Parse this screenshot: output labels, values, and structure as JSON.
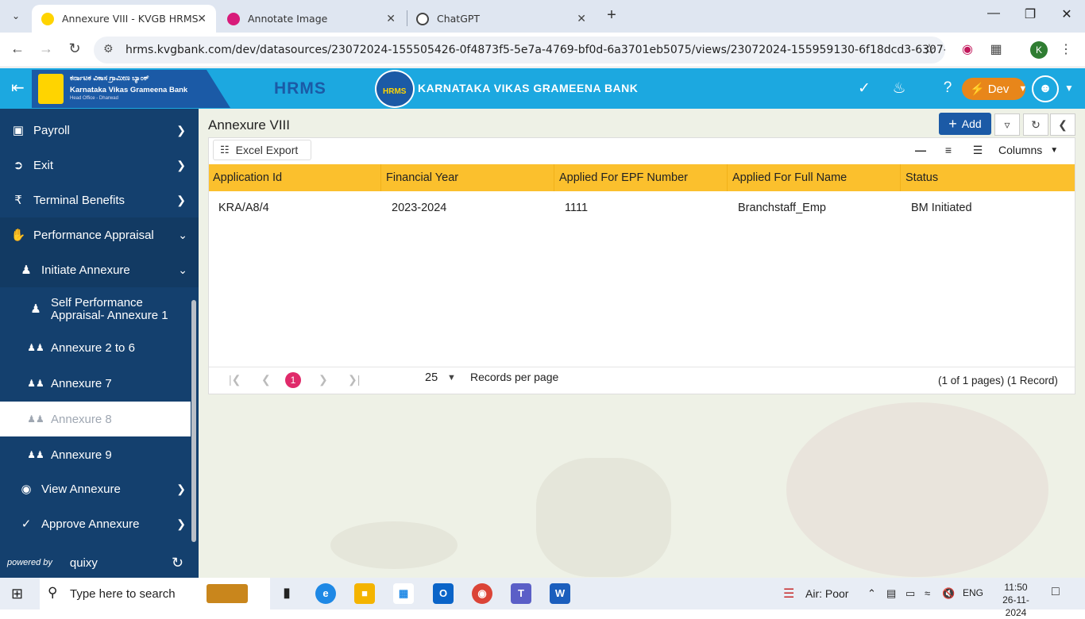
{
  "browser": {
    "tabs": [
      {
        "title": "Annexure VIII - KVGB HRMS",
        "active": true
      },
      {
        "title": "Annotate Image",
        "active": false
      },
      {
        "title": "ChatGPT",
        "active": false
      }
    ],
    "url": "hrms.kvgbank.com/dev/datasources/23072024-155505426-0f4873f5-5e7a-4769-bf0d-6a3701eb5075/views/23072024-155959130-6f18dcd3-6307-4718-9fb4-...",
    "profile_initial": "K"
  },
  "appbar": {
    "logo_kannada": "ಕರ್ನಾಟಕ ವಿಕಾಸ ಗ್ರಾಮೀಣ ಬ್ಯಾಂಕ್",
    "logo_english": "Karnataka Vikas Grameena Bank",
    "logo_sub": "Head Office - Dharwad",
    "title": "HRMS",
    "emblem_text": "HRMS",
    "bank_name": "KARNATAKA VIKAS GRAMEENA BANK",
    "env_label": "Dev",
    "accent_color": "#1ca8e0",
    "brand_color": "#1b5aa6"
  },
  "sidebar": {
    "items": [
      {
        "label": "Payroll",
        "icon": "money-icon"
      },
      {
        "label": "Exit",
        "icon": "exit-icon"
      },
      {
        "label": "Terminal Benefits",
        "icon": "rupee-icon"
      },
      {
        "label": "Performance Appraisal",
        "icon": "handshake-icon"
      },
      {
        "label": "Initiate Annexure",
        "icon": "user-icon"
      },
      {
        "label": "Self Performance Appraisal- Annexure 1",
        "icon": "user-icon"
      },
      {
        "label": "Annexure 2 to 6",
        "icon": "users-icon"
      },
      {
        "label": "Annexure 7",
        "icon": "users-icon"
      },
      {
        "label": "Annexure 8",
        "icon": "users-icon",
        "active": true
      },
      {
        "label": "Annexure 9",
        "icon": "users-icon"
      },
      {
        "label": "View Annexure",
        "icon": "eye-icon"
      },
      {
        "label": "Approve Annexure",
        "icon": "check-icon"
      }
    ],
    "powered_by": "powered by",
    "brand": "quixy"
  },
  "page": {
    "title": "Annexure VIII",
    "add_label": "Add",
    "excel_label": "Excel Export",
    "columns_label": "Columns"
  },
  "table": {
    "columns": [
      "Application Id",
      "Financial Year",
      "Applied For EPF Number",
      "Applied For Full Name",
      "Status"
    ],
    "rows": [
      [
        "KRA/A8/4",
        "2023-2024",
        "1111",
        "Branchstaff_Emp",
        "BM Initiated"
      ]
    ],
    "header_color": "#fbc02d"
  },
  "pager": {
    "current_page": "1",
    "page_size": "25",
    "rpp_label": "Records per page",
    "info": "(1 of 1 pages) (1 Record)"
  },
  "taskbar": {
    "search_placeholder": "Type here to search",
    "air_quality": "Air: Poor",
    "language": "ENG",
    "time": "11:50",
    "date": "26-11-2024"
  }
}
